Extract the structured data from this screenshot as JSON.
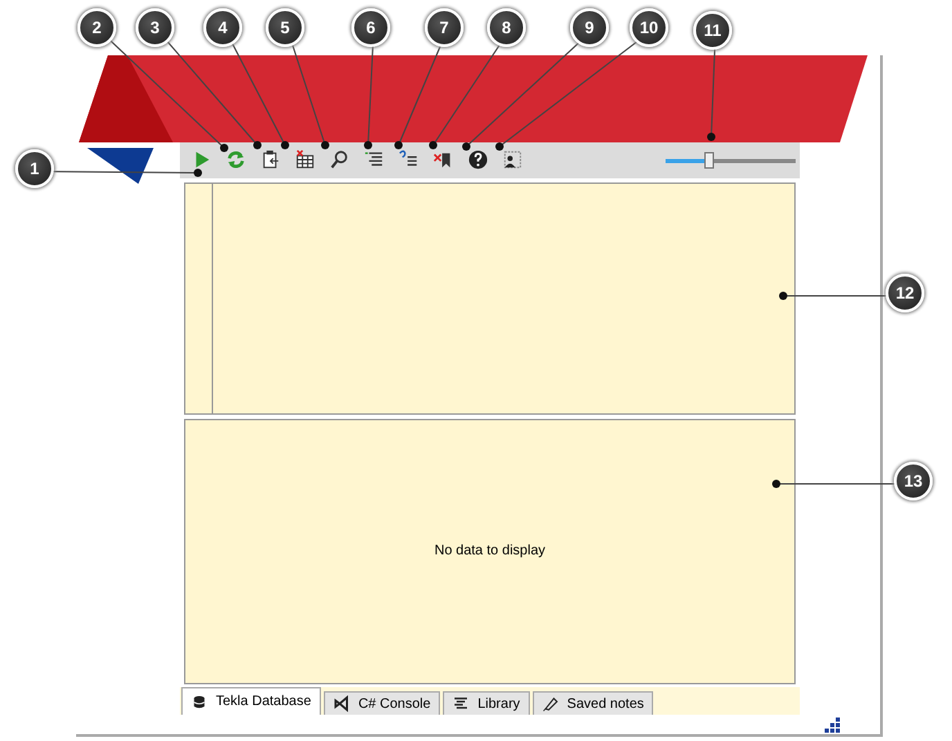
{
  "callouts": [
    "1",
    "2",
    "3",
    "4",
    "5",
    "6",
    "7",
    "8",
    "9",
    "10",
    "11",
    "12",
    "13"
  ],
  "zoom_slider": {
    "level": 0.33
  },
  "results_panel": {
    "message": "No data to display"
  },
  "tabs": [
    {
      "label": "Tekla Database",
      "selected": true
    },
    {
      "label": "C# Console",
      "selected": false
    },
    {
      "label": "Library",
      "selected": false
    },
    {
      "label": "Saved notes",
      "selected": false
    }
  ]
}
